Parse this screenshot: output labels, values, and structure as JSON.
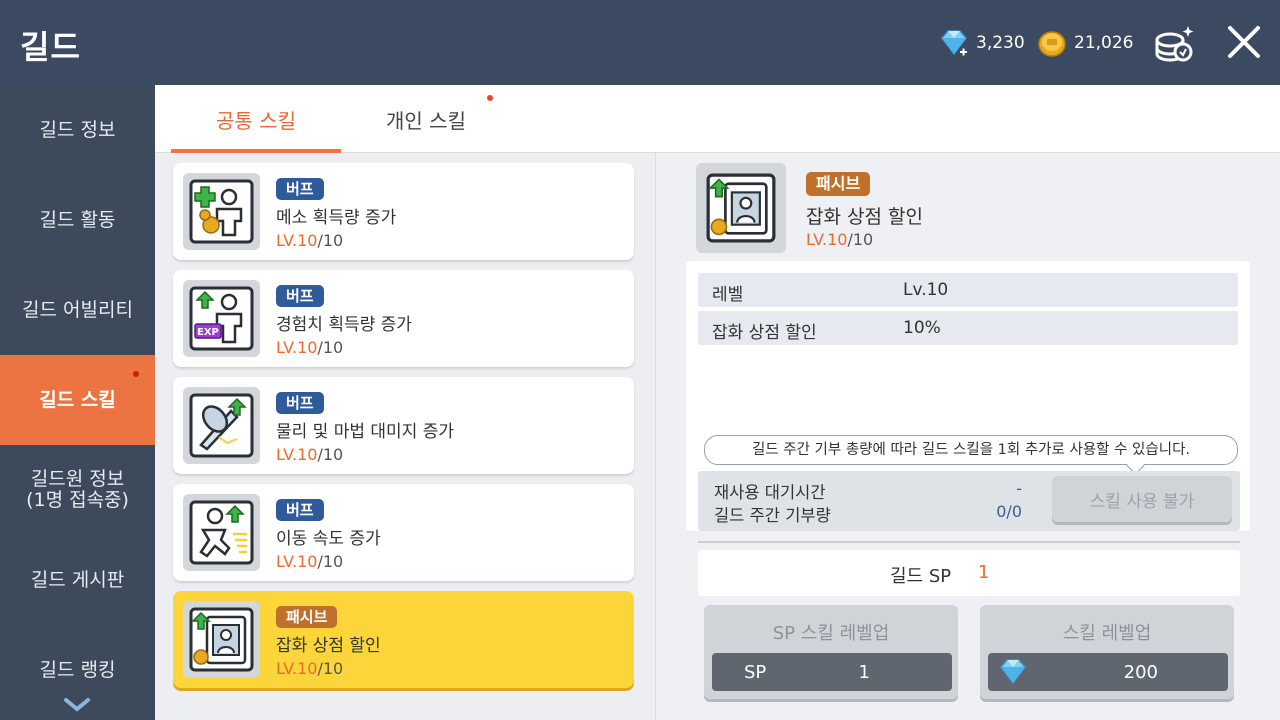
{
  "header": {
    "title": "길드",
    "diamond_amount": "3,230",
    "coin_amount": "21,026"
  },
  "sidebar": {
    "items": [
      {
        "label": "길드 정보"
      },
      {
        "label": "길드 활동"
      },
      {
        "label": "길드 어빌리티"
      },
      {
        "label": "길드 스킬"
      },
      {
        "label": "길드원 정보\n(1명 접속중)"
      },
      {
        "label": "길드 게시판"
      },
      {
        "label": "길드 랭킹"
      }
    ]
  },
  "tabs": [
    {
      "label": "공통 스킬"
    },
    {
      "label": "개인 스킬"
    }
  ],
  "skills": [
    {
      "type": "버프",
      "name": "메소 획득량 증가",
      "level": "LV.10",
      "max": "/10"
    },
    {
      "type": "버프",
      "name": "경험치 획득량 증가",
      "level": "LV.10",
      "max": "/10"
    },
    {
      "type": "버프",
      "name": "물리 및 마법 대미지 증가",
      "level": "LV.10",
      "max": "/10"
    },
    {
      "type": "버프",
      "name": "이동 속도 증가",
      "level": "LV.10",
      "max": "/10"
    },
    {
      "type": "패시브",
      "name": "잡화 상점 할인",
      "level": "LV.10",
      "max": "/10"
    }
  ],
  "detail": {
    "type": "패시브",
    "name": "잡화 상점 할인",
    "level": "LV.10",
    "max": "/10",
    "stats": [
      {
        "key": "레벨",
        "value": "Lv.10"
      },
      {
        "key": "잡화 상점 할인",
        "value": "10%"
      }
    ],
    "tooltip": "길드 주간 기부 총량에 따라 길드 스킬을 1회 추가로 사용할 수 있습니다.",
    "cooldown_label": "재사용 대기시간",
    "cooldown_value": "-",
    "donation_label": "길드 주간 기부량",
    "donation_value": "0/0",
    "use_button": "스킬 사용 불가",
    "sp_label": "길드 SP",
    "sp_value": "1",
    "sp_levelup": {
      "label": "SP 스킬 레벨업",
      "cost_label": "SP",
      "cost": "1"
    },
    "levelup": {
      "label": "스킬 레벨업",
      "cost": "200"
    }
  }
}
